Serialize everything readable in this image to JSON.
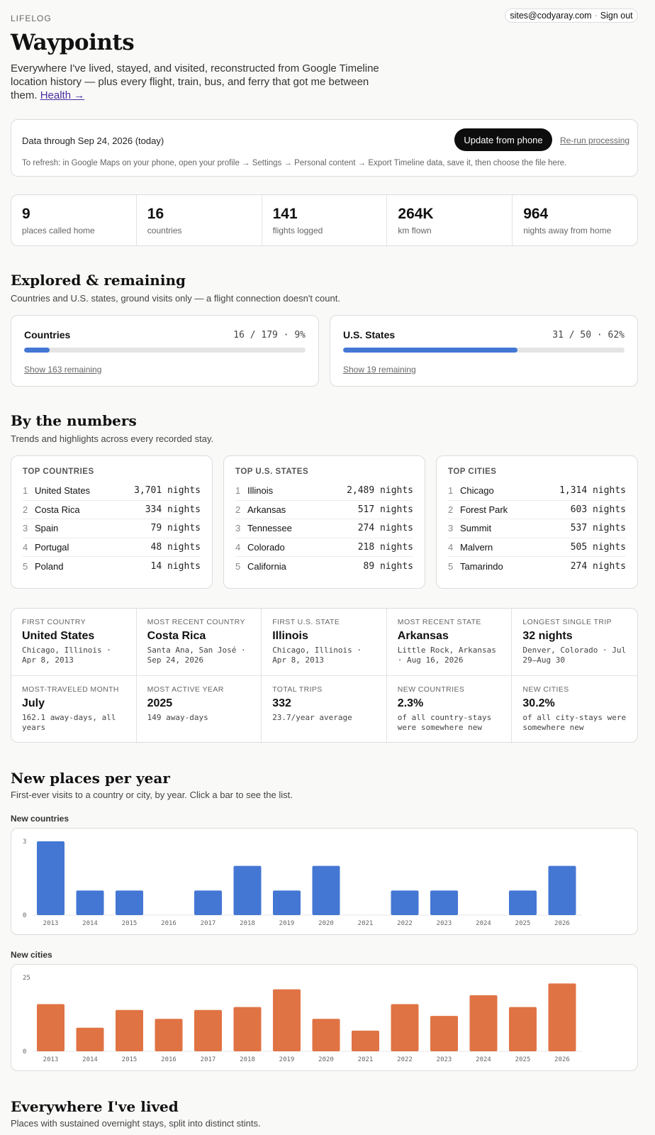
{
  "header": {
    "eyebrow": "LIFELOG",
    "email": "sites@codyaray.com",
    "separator": "·",
    "sign_out": "Sign out",
    "title": "Waypoints",
    "intro": "Everywhere I've lived, stayed, and visited, reconstructed from Google Timeline location history — plus every flight, train, bus, and ferry that got me between them.",
    "health_link": "Health →"
  },
  "data_card": {
    "through": "Data through Sep 24, 2026 (today)",
    "update_button": "Update from phone",
    "rerun_link": "Re-run processing",
    "help": "To refresh: in Google Maps on your phone, open your profile → Settings → Personal content → Export Timeline data, save it, then choose the file here."
  },
  "stats": [
    {
      "value": "9",
      "label": "places called home"
    },
    {
      "value": "16",
      "label": "countries"
    },
    {
      "value": "141",
      "label": "flights logged"
    },
    {
      "value": "264K",
      "label": "km flown"
    },
    {
      "value": "964",
      "label": "nights away from home"
    }
  ],
  "explored": {
    "title": "Explored & remaining",
    "subtitle": "Countries and U.S. states, ground visits only — a flight connection doesn't count.",
    "countries": {
      "name": "Countries",
      "ratio": "16 / 179 · 9%",
      "fraction": 0.09,
      "show": "Show 163 remaining"
    },
    "states": {
      "name": "U.S. States",
      "ratio": "31 / 50 · 62%",
      "fraction": 0.62,
      "show": "Show 19 remaining"
    }
  },
  "numbers": {
    "title": "By the numbers",
    "subtitle": "Trends and highlights across every recorded stay.",
    "top_countries": {
      "heading": "TOP COUNTRIES",
      "rows": [
        {
          "rank": "1",
          "name": "United States",
          "value": "3,701 nights"
        },
        {
          "rank": "2",
          "name": "Costa Rica",
          "value": "334 nights"
        },
        {
          "rank": "3",
          "name": "Spain",
          "value": "79 nights"
        },
        {
          "rank": "4",
          "name": "Portugal",
          "value": "48 nights"
        },
        {
          "rank": "5",
          "name": "Poland",
          "value": "14 nights"
        }
      ]
    },
    "top_states": {
      "heading": "TOP U.S. STATES",
      "rows": [
        {
          "rank": "1",
          "name": "Illinois",
          "value": "2,489 nights"
        },
        {
          "rank": "2",
          "name": "Arkansas",
          "value": "517 nights"
        },
        {
          "rank": "3",
          "name": "Tennessee",
          "value": "274 nights"
        },
        {
          "rank": "4",
          "name": "Colorado",
          "value": "218 nights"
        },
        {
          "rank": "5",
          "name": "California",
          "value": "89 nights"
        }
      ]
    },
    "top_cities": {
      "heading": "TOP CITIES",
      "rows": [
        {
          "rank": "1",
          "name": "Chicago",
          "value": "1,314 nights"
        },
        {
          "rank": "2",
          "name": "Forest Park",
          "value": "603 nights"
        },
        {
          "rank": "3",
          "name": "Summit",
          "value": "537 nights"
        },
        {
          "rank": "4",
          "name": "Malvern",
          "value": "505 nights"
        },
        {
          "rank": "5",
          "name": "Tamarindo",
          "value": "274 nights"
        }
      ]
    },
    "facts": [
      {
        "key": "FIRST COUNTRY",
        "value": "United States",
        "detail": "Chicago, Illinois · Apr 8, 2013"
      },
      {
        "key": "MOST RECENT COUNTRY",
        "value": "Costa Rica",
        "detail": "Santa Ana, San José · Sep 24, 2026"
      },
      {
        "key": "FIRST U.S. STATE",
        "value": "Illinois",
        "detail": "Chicago, Illinois · Apr 8, 2013"
      },
      {
        "key": "MOST RECENT STATE",
        "value": "Arkansas",
        "detail": "Little Rock, Arkansas · Aug 16, 2026"
      },
      {
        "key": "LONGEST SINGLE TRIP",
        "value": "32 nights",
        "detail": "Denver, Colorado · Jul 29–Aug 30"
      },
      {
        "key": "MOST-TRAVELED MONTH",
        "value": "July",
        "detail": "162.1 away-days, all years"
      },
      {
        "key": "MOST ACTIVE YEAR",
        "value": "2025",
        "detail": "149 away-days"
      },
      {
        "key": "TOTAL TRIPS",
        "value": "332",
        "detail": "23.7/year average"
      },
      {
        "key": "NEW COUNTRIES",
        "value": "2.3%",
        "detail": "of all country-stays were somewhere new"
      },
      {
        "key": "NEW CITIES",
        "value": "30.2%",
        "detail": "of all city-stays were somewhere new"
      }
    ]
  },
  "new_places": {
    "title": "New places per year",
    "subtitle": "First-ever visits to a country or city, by year. Click a bar to see the list."
  },
  "chart_data": [
    {
      "type": "bar",
      "title": "New countries",
      "categories": [
        "2013",
        "2014",
        "2015",
        "2016",
        "2017",
        "2018",
        "2019",
        "2020",
        "2021",
        "2022",
        "2023",
        "2024",
        "2025",
        "2026"
      ],
      "values": [
        3,
        1,
        1,
        0,
        1,
        2,
        1,
        2,
        0,
        1,
        1,
        0,
        1,
        2
      ],
      "ylim": [
        0,
        3
      ],
      "yticks": [
        "3",
        "0"
      ],
      "color": "#4477d4"
    },
    {
      "type": "bar",
      "title": "New cities",
      "categories": [
        "2013",
        "2014",
        "2015",
        "2016",
        "2017",
        "2018",
        "2019",
        "2020",
        "2021",
        "2022",
        "2023",
        "2024",
        "2025",
        "2026"
      ],
      "values": [
        16,
        8,
        14,
        11,
        14,
        15,
        21,
        11,
        7,
        16,
        12,
        19,
        15,
        23
      ],
      "ylim": [
        0,
        25
      ],
      "yticks": [
        "25",
        "0"
      ],
      "color": "#e07344"
    }
  ],
  "lived": {
    "title": "Everywhere I've lived",
    "subtitle": "Places with sustained overnight stays, split into distinct stints."
  }
}
